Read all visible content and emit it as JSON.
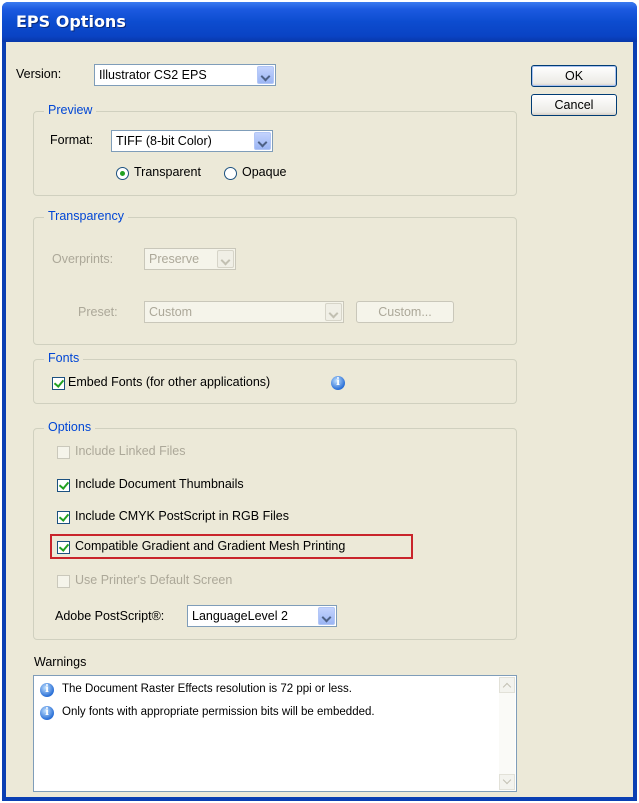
{
  "window": {
    "title": "EPS Options"
  },
  "version": {
    "label": "Version:",
    "value": "Illustrator CS2 EPS"
  },
  "buttons": {
    "ok": "OK",
    "cancel": "Cancel"
  },
  "preview": {
    "legend": "Preview",
    "format_label": "Format:",
    "format_value": "TIFF (8-bit Color)",
    "transparent": "Transparent",
    "opaque": "Opaque",
    "selected": "Transparent"
  },
  "transparency": {
    "legend": "Transparency",
    "overprints_label": "Overprints:",
    "overprints_value": "Preserve",
    "preset_label": "Preset:",
    "preset_value": "Custom",
    "custom_button": "Custom..."
  },
  "fonts": {
    "legend": "Fonts",
    "embed_fonts": "Embed Fonts (for other applications)",
    "embed_checked": true,
    "info_icon": "info-icon"
  },
  "options": {
    "legend": "Options",
    "include_linked": "Include Linked Files",
    "include_linked_checked": false,
    "include_thumbnails": "Include Document Thumbnails",
    "include_thumbnails_checked": true,
    "include_cmyk": "Include CMYK PostScript in RGB Files",
    "include_cmyk_checked": true,
    "compatible_gradient": "Compatible Gradient and Gradient Mesh Printing",
    "compatible_gradient_checked": true,
    "printer_screen": "Use Printer's Default Screen",
    "printer_screen_checked": false,
    "postscript_label": "Adobe PostScript®:",
    "postscript_value": "LanguageLevel 2"
  },
  "warnings": {
    "label": "Warnings",
    "items": [
      "The Document Raster Effects resolution is 72 ppi or less.",
      "Only fonts with appropriate permission bits will be embedded."
    ]
  },
  "colors": {
    "title_bar": "#0c4ccf",
    "dialog_bg": "#ece9d8",
    "legend_text": "#0046d5",
    "highlight": "#c9242b",
    "check": "#21a121"
  }
}
